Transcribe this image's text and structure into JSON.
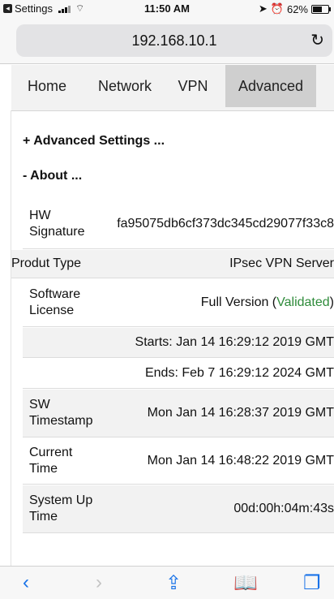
{
  "status_bar": {
    "app_back_label": "Settings",
    "time": "11:50 AM",
    "battery_percent": "62%",
    "battery_level": 0.62
  },
  "browser": {
    "url": "192.168.10.1",
    "reload_icon": "reload-icon"
  },
  "nav": {
    "tabs": [
      {
        "label": "Home"
      },
      {
        "label": "Network"
      },
      {
        "label": "VPN"
      },
      {
        "label": "Advanced",
        "active": true
      }
    ]
  },
  "sections": {
    "advanced_settings": "+ Advanced Settings ...",
    "about": "- About ..."
  },
  "about": {
    "hw_signature_label": "HW Signature",
    "hw_signature_value": "fa95075db6cf373dc345cd29077f33c8",
    "product_type_label": "Produt Type",
    "product_type_value": "IPsec VPN Server",
    "software_license_label": "Software License",
    "software_license_prefix": "Full Version (",
    "software_license_status": "Validated",
    "software_license_suffix": ")",
    "starts": "Starts: Jan 14 16:29:12 2019 GMT",
    "ends": "Ends: Feb 7 16:29:12 2024 GMT",
    "sw_timestamp_label": "SW Timestamp",
    "sw_timestamp_value": "Mon Jan 14 16:28:37 2019 GMT",
    "current_time_label": "Current Time",
    "current_time_value": "Mon Jan 14 16:48:22 2019 GMT",
    "uptime_label": "System Up Time",
    "uptime_value": "00d:00h:04m:43s"
  },
  "colors": {
    "accent": "#1a73e8",
    "validated": "#2e8b3a",
    "active_tab": "#cfcfcf"
  }
}
